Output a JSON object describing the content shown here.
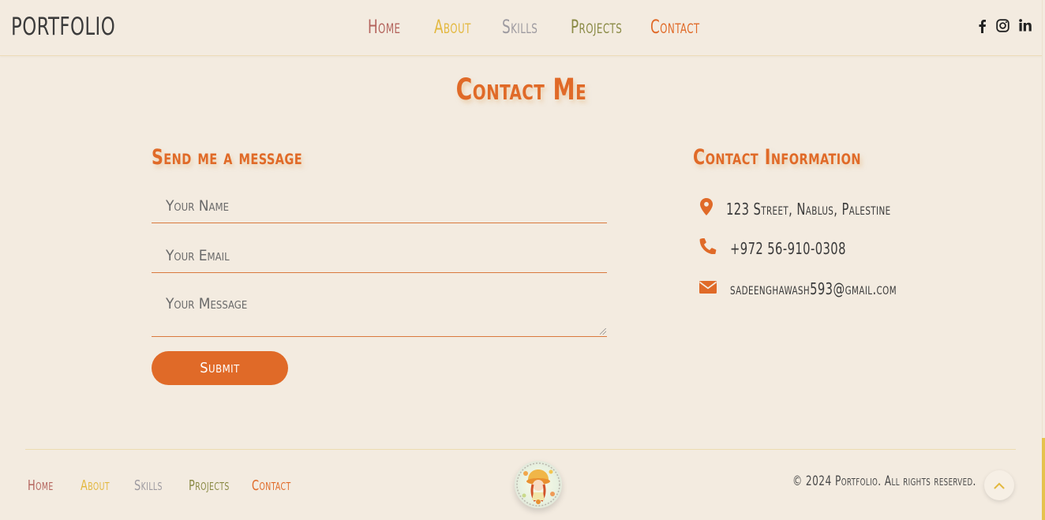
{
  "header": {
    "logo": "PORTFOLIO",
    "nav": [
      {
        "label": "Home",
        "color": "#b4645d"
      },
      {
        "label": "About",
        "color": "#e3b83f"
      },
      {
        "label": "Skills",
        "color": "#9d9aa0"
      },
      {
        "label": "Projects",
        "color": "#8a8a45"
      },
      {
        "label": "Contact",
        "color": "#e06a28"
      }
    ],
    "social": [
      "facebook-icon",
      "instagram-icon",
      "linkedin-icon"
    ]
  },
  "contact": {
    "title": "Contact Me",
    "form": {
      "heading": "Send me a message",
      "name_placeholder": "Your Name",
      "email_placeholder": "Your Email",
      "message_placeholder": "Your Message",
      "submit_label": "Submit"
    },
    "info": {
      "heading": "Contact Information",
      "address": "123 Street, Nablus, Palestine",
      "phone": "+972 56-910-0308",
      "email": "sadeenghawash593@gmail.com"
    }
  },
  "footer": {
    "nav": [
      {
        "label": "Home",
        "color": "#b4645d"
      },
      {
        "label": "About",
        "color": "#e3b83f"
      },
      {
        "label": "Skills",
        "color": "#9d9aa0"
      },
      {
        "label": "Projects",
        "color": "#8a8a45"
      },
      {
        "label": "Contact",
        "color": "#e06a28"
      }
    ],
    "copyright": "© 2024 Portfolio. All rights reserved."
  },
  "colors": {
    "accent": "#e06a28",
    "background": "#f3ebe0",
    "scroll_thumb": "#e6c34d"
  }
}
